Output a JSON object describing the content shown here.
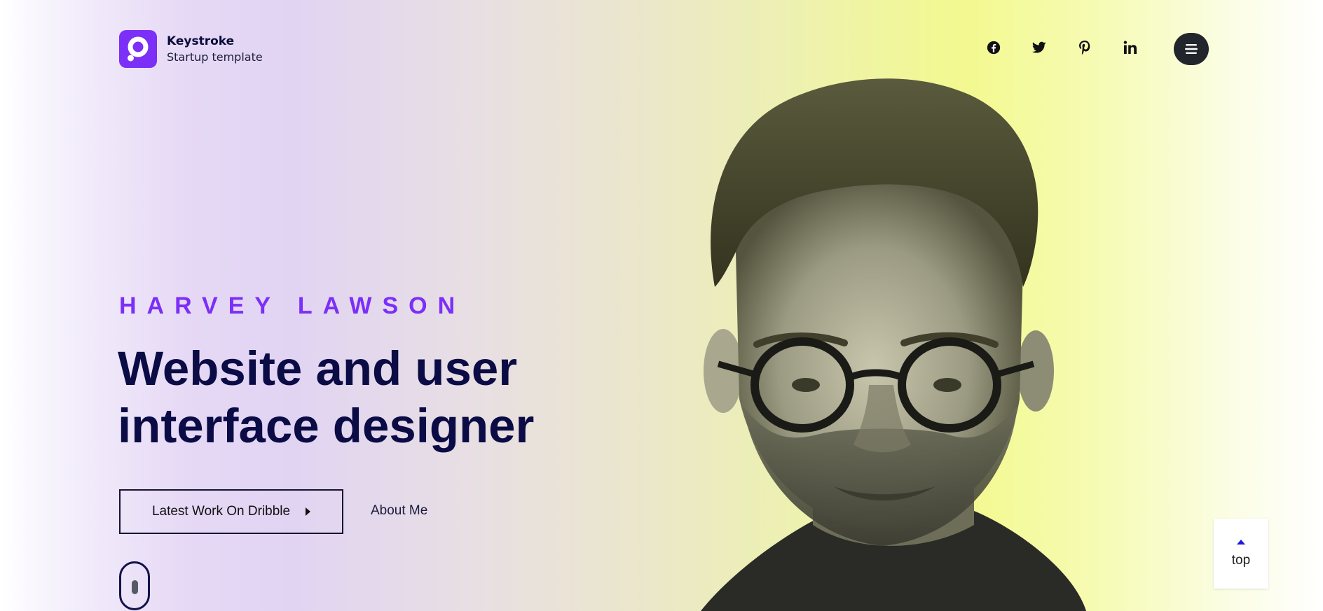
{
  "brand": {
    "title": "Keystroke",
    "subtitle": "Startup template",
    "accent_color": "#7b2ff7"
  },
  "social": [
    {
      "name": "facebook",
      "icon": "facebook-icon"
    },
    {
      "name": "twitter",
      "icon": "twitter-icon"
    },
    {
      "name": "pinterest",
      "icon": "pinterest-icon"
    },
    {
      "name": "linkedin",
      "icon": "linkedin-icon"
    }
  ],
  "menu": {
    "icon": "hamburger-menu-icon"
  },
  "hero": {
    "eyebrow": "HARVEY LAWSON",
    "headline_line1": "Website and user",
    "headline_line2": "interface designer",
    "cta_label": "Latest Work On Dribble",
    "secondary_link": "About Me",
    "heading_color": "#0b0b45"
  },
  "back_to_top": {
    "label": "top"
  }
}
